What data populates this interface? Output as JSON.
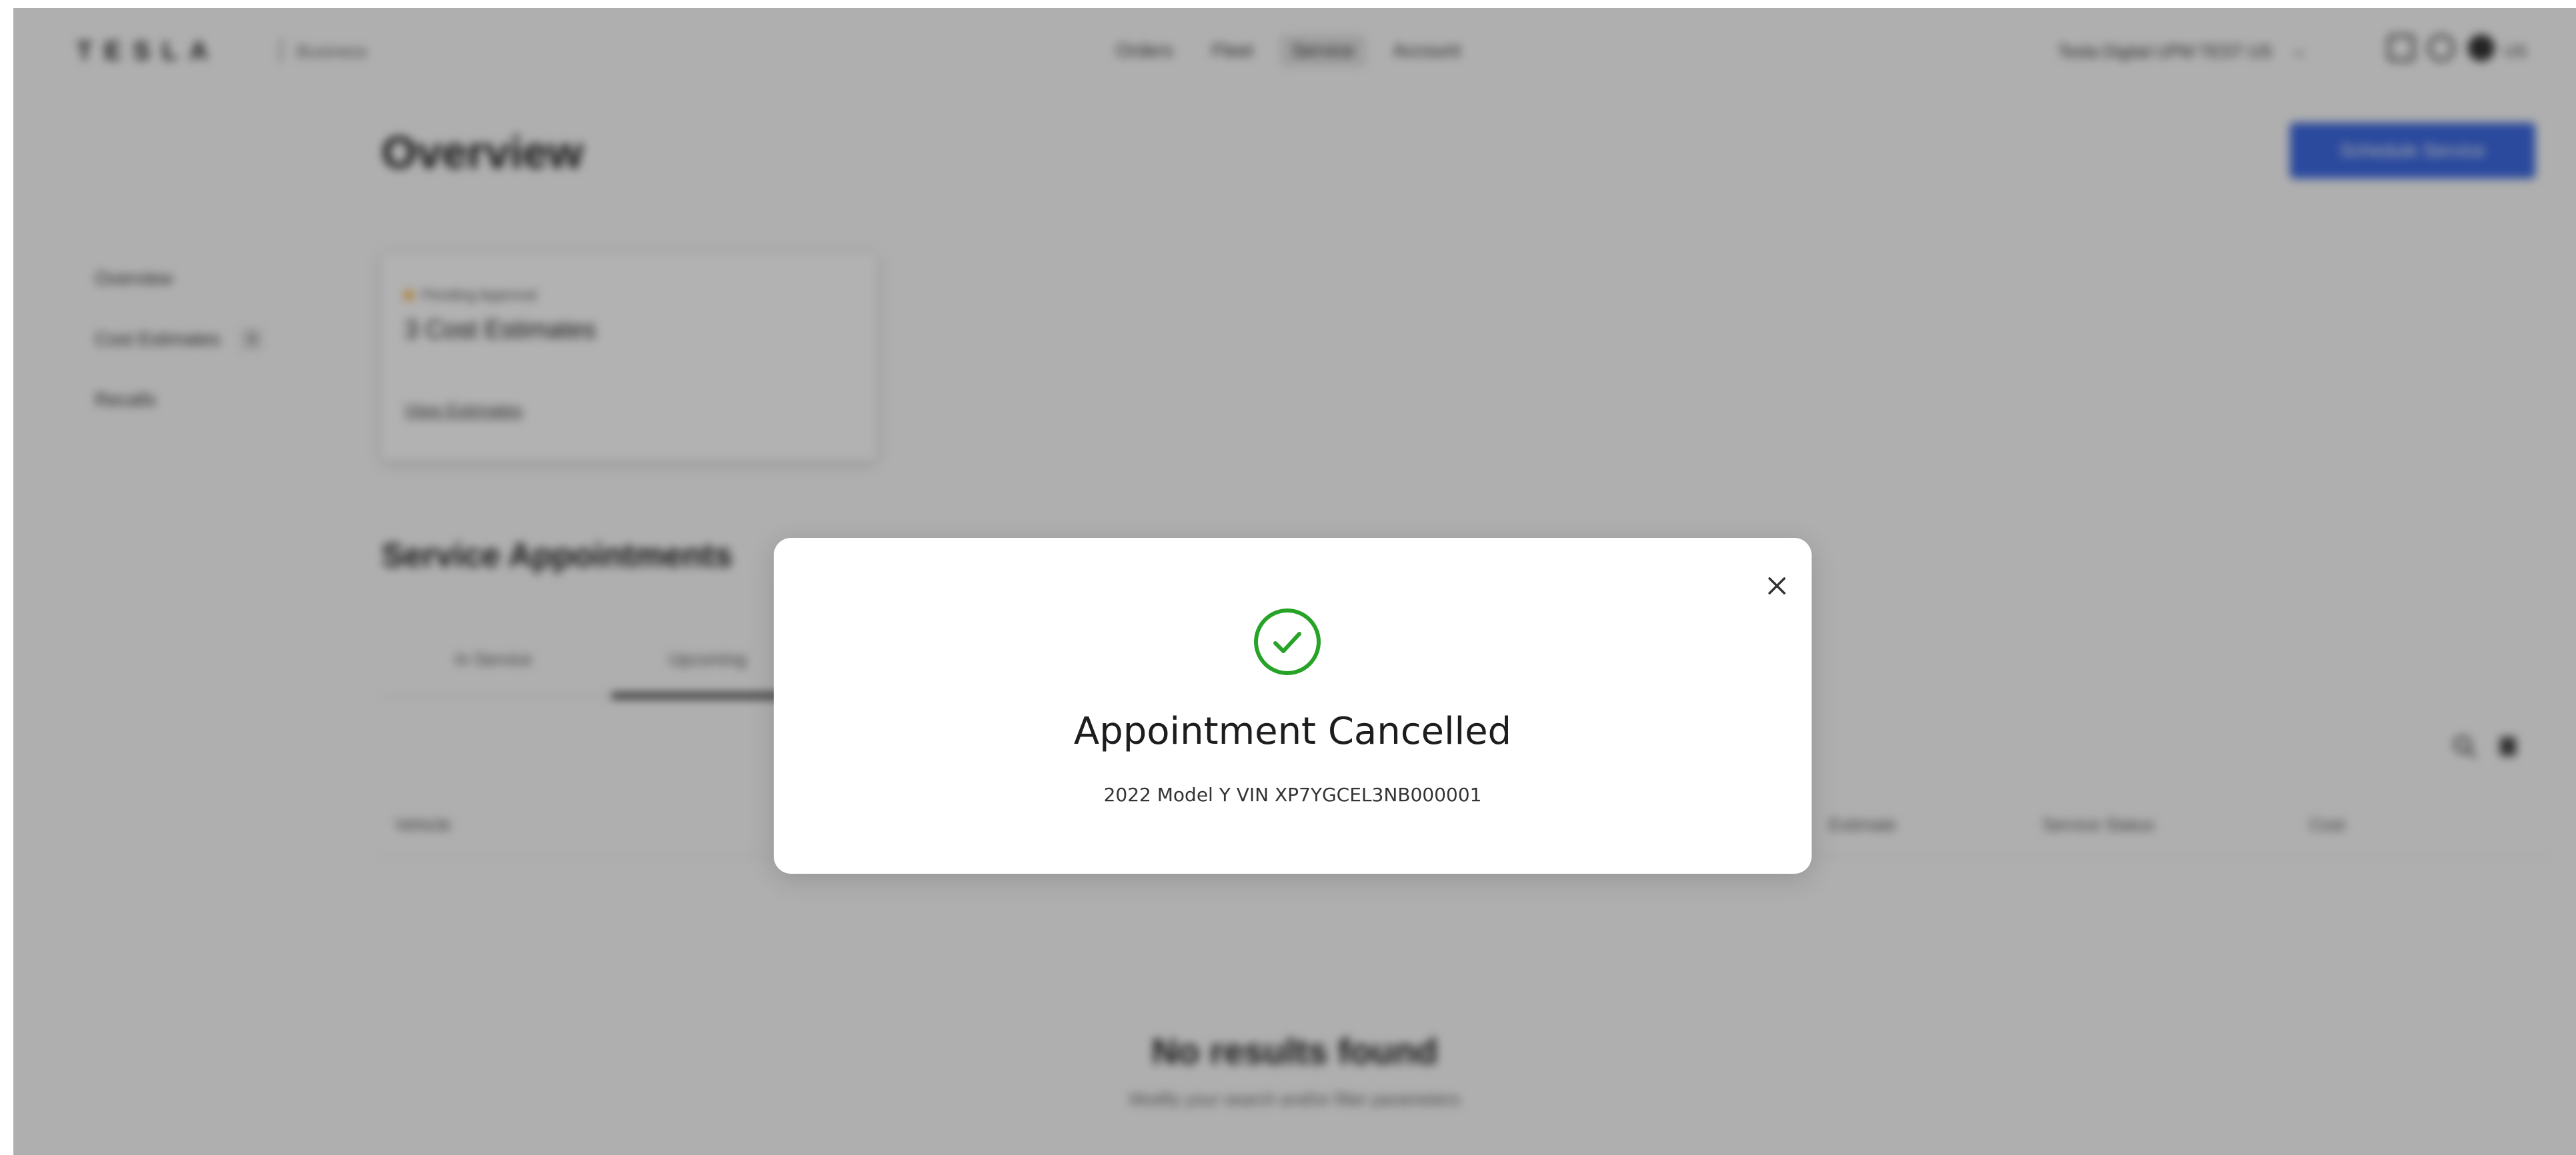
{
  "header": {
    "logo": "TESLA",
    "sub_brand": "Business",
    "nav": [
      "Orders",
      "Fleet",
      "Service",
      "Account"
    ],
    "active_nav": "Service",
    "account_name": "Tesla Digital UPM TEST US",
    "locale": "US",
    "icons": [
      "notification-icon",
      "help-icon",
      "globe-icon"
    ]
  },
  "main": {
    "title": "Overview",
    "primary_button": "Schedule Service",
    "sidebar": [
      {
        "label": "Overview"
      },
      {
        "label": "Cost Estimates",
        "badge": "3"
      },
      {
        "label": "Recalls"
      }
    ],
    "estimate_card": {
      "status": "Pending Approval",
      "title": "3 Cost Estimates",
      "link": "View Estimates"
    },
    "section_title": "Service Appointments",
    "tabs": [
      "In Service",
      "Upcoming"
    ],
    "active_tab": "Upcoming",
    "table_headers": [
      "Vehicle",
      "Estimate",
      "Service Status",
      "Cost"
    ],
    "empty": {
      "title": "No results found",
      "subtitle": "Modify your search and/or filter parameters"
    }
  },
  "modal": {
    "title": "Appointment Cancelled",
    "subtitle": "2022 Model Y VIN XP7YGCEL3NB000001",
    "success_color": "#27a327"
  },
  "colors": {
    "accent": "#3e6ae1",
    "pending": "#f5a623"
  }
}
